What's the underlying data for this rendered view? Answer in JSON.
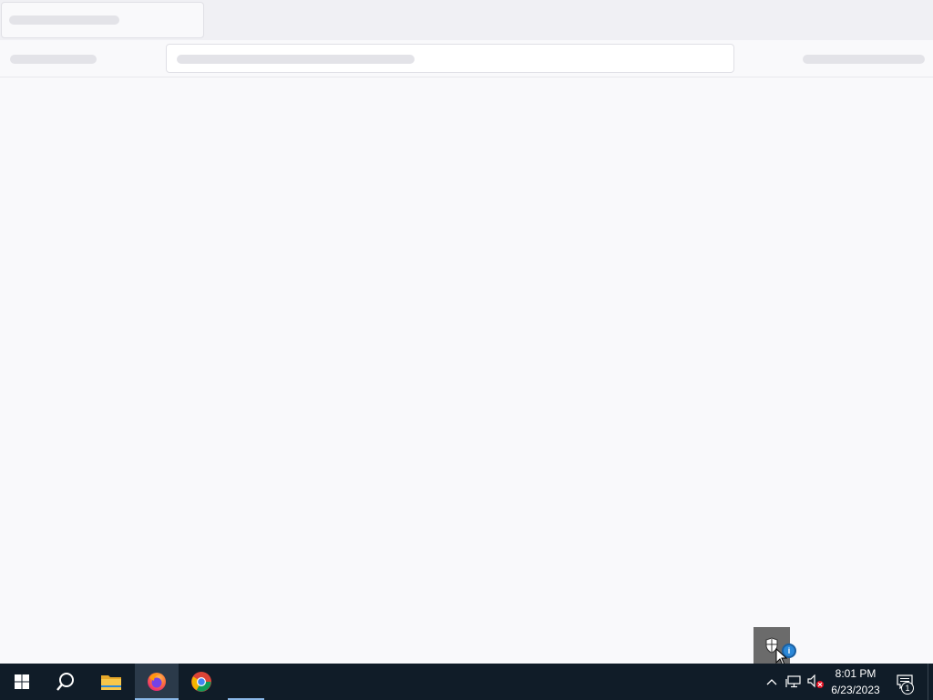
{
  "taskbar": {
    "clock": {
      "time": "8:01 PM",
      "date": "6/23/2023"
    },
    "notification_count": "1",
    "apps": [
      {
        "name": "Start",
        "icon": "windows-logo-icon"
      },
      {
        "name": "Search",
        "icon": "search-icon"
      },
      {
        "name": "File Explorer",
        "icon": "folder-icon"
      },
      {
        "name": "Firefox",
        "icon": "firefox-icon",
        "active": true
      },
      {
        "name": "Google Chrome",
        "icon": "chrome-icon"
      }
    ],
    "tray": [
      "chevron-up-icon",
      "network-icon",
      "volume-muted-icon",
      "action-center-icon"
    ]
  },
  "tray_flyout": {
    "icon": "windows-security-shield-icon",
    "badge": "i"
  },
  "colors": {
    "taskbar_bg": "#101c28",
    "page_bg": "#f9f9fb",
    "skeleton": "#e3e3e8",
    "accent": "#2b88d8"
  }
}
